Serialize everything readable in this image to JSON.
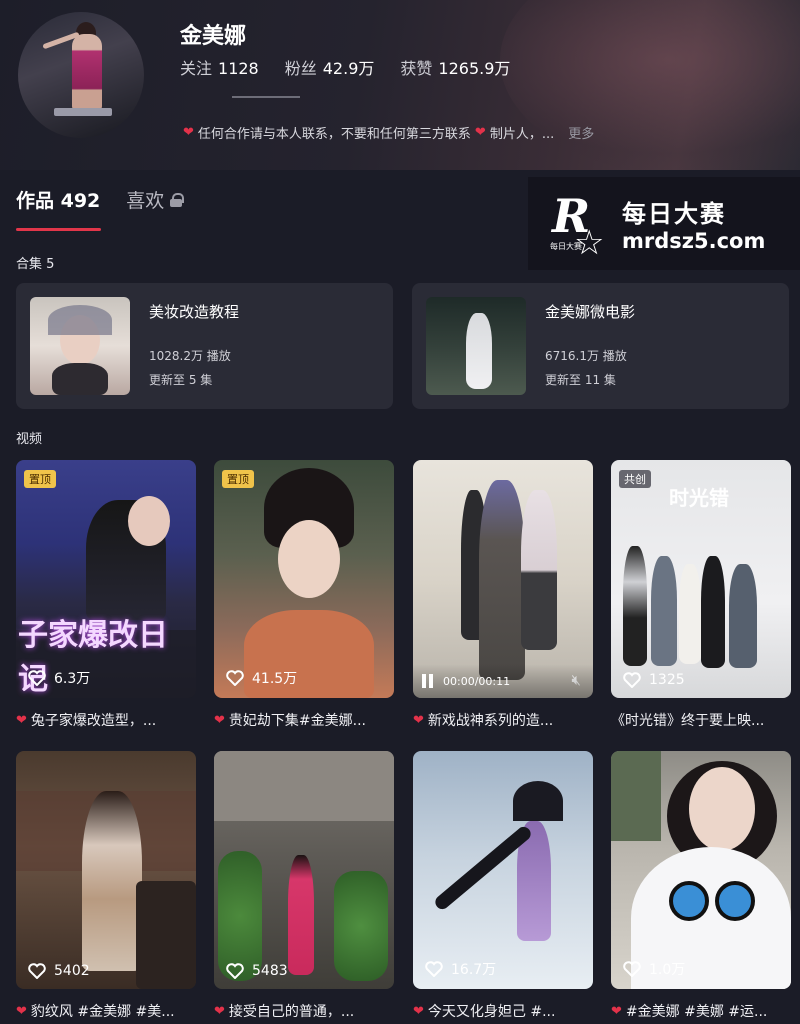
{
  "profile": {
    "name": "金美娜",
    "stats": [
      {
        "label": "关注",
        "value": "1128"
      },
      {
        "label": "粉丝",
        "value": "42.9万"
      },
      {
        "label": "获赞",
        "value": "1265.9万"
      }
    ],
    "bio_part1": "任何合作请与本人联系，不要和任何第三方联系",
    "bio_part2": "制片人，...",
    "bio_more": "更多"
  },
  "tabs": {
    "works_label": "作品 492",
    "likes_label": "喜欢"
  },
  "watermark": {
    "logo_letter": "R",
    "logo_small": "每日大赛",
    "title": "每日大赛",
    "url": "mrdsz5.com"
  },
  "collections": {
    "label": "合集 5",
    "items": [
      {
        "title": "美妆改造教程",
        "plays": "1028.2万 播放",
        "updated": "更新至 5 集"
      },
      {
        "title": "金美娜微电影",
        "plays": "6716.1万 播放",
        "updated": "更新至 11 集"
      }
    ]
  },
  "videos": {
    "label": "视频",
    "items": [
      {
        "badge": "置顶",
        "overlay": "子家爆改日记",
        "likes": "6.3万",
        "caption": "兔子家爆改造型，..."
      },
      {
        "badge": "置顶",
        "overlay": "",
        "likes": "41.5万",
        "caption": "贵妃劫下集#金美娜..."
      },
      {
        "badge": "",
        "overlay": "",
        "time": "00:00/00:11",
        "likes": "",
        "caption": "新戏战神系列的造..."
      },
      {
        "badge": "共创",
        "overlay": "时光错",
        "likes": "1325",
        "caption": "《时光错》终于要上映..."
      },
      {
        "badge": "",
        "overlay": "",
        "likes": "5402",
        "caption": "豹纹风 #金美娜 #美..."
      },
      {
        "badge": "",
        "overlay": "",
        "likes": "5483",
        "caption": "接受自己的普通，..."
      },
      {
        "badge": "",
        "overlay": "",
        "likes": "16.7万",
        "caption": "今天又化身妲己 #..."
      },
      {
        "badge": "",
        "overlay": "",
        "likes": "1.0万",
        "caption": "#金美娜 #美娜 #运..."
      }
    ]
  },
  "colors": {
    "accent_red": "#e2364a",
    "pin_badge": "#f0c34a",
    "background": "#1b1c27",
    "card": "#2a2b36"
  }
}
